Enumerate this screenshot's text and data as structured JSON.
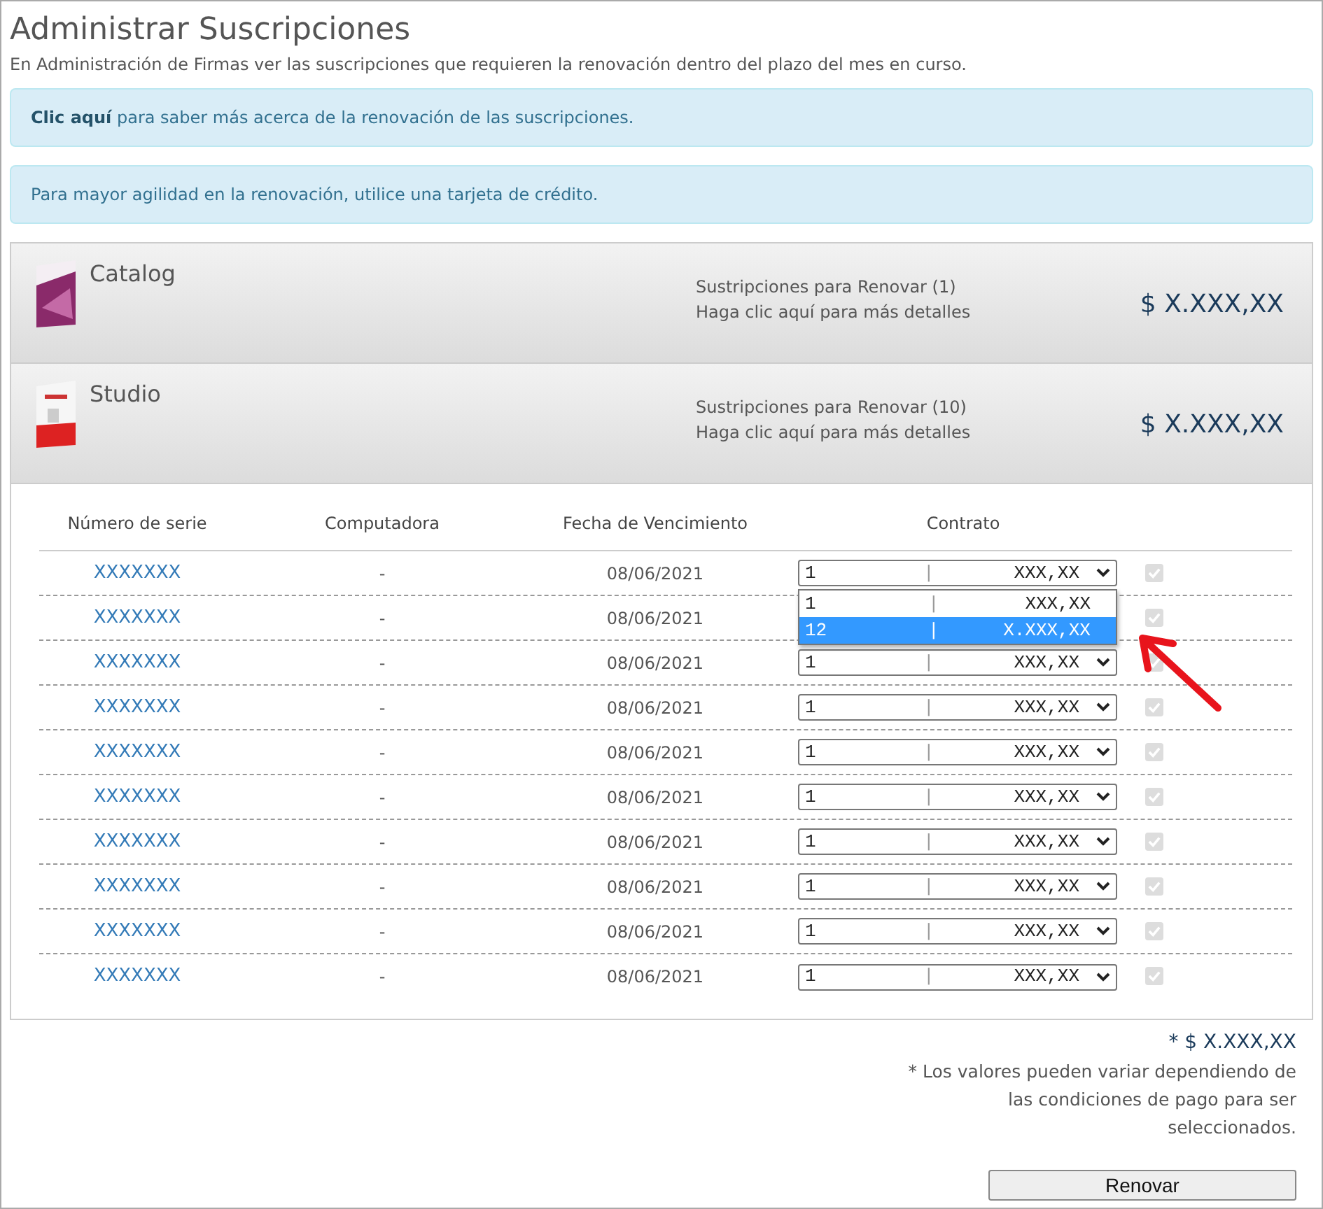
{
  "title": "Administrar Suscripciones",
  "subtitle": "En Administración de Firmas ver las suscripciones que requieren la renovación dentro del plazo del mes en curso.",
  "alerts": [
    {
      "text": "**Clic aquí** para saber más acerca de la renovación de las suscripciones."
    },
    {
      "text": "Para mayor agilidad en la renovación, utilice una tarjeta de crédito."
    }
  ],
  "products": [
    {
      "name": "Catalog",
      "kind": "catalog",
      "info": "Sustripciones para Renovar (1)",
      "details": "Haga clic aquí para más detalles",
      "price": "$ X.XXX,XX"
    },
    {
      "name": "Studio",
      "kind": "studio",
      "info": "Sustripciones para Renovar (10)",
      "details": "Haga clic aquí para más detalles",
      "price": "$ X.XXX,XX"
    }
  ],
  "table": {
    "columns": [
      "Número de serie",
      "Computadora",
      "Fecha de Vencimiento",
      "Contrato"
    ],
    "rows": [
      {
        "serial": "XXXXXXX",
        "computer": "-",
        "date": "08/06/2021",
        "contract": {
          "qty": "1",
          "sep": "|",
          "price": "XXX,XX"
        },
        "checked": true,
        "disabled": true,
        "dropdown": [
          {
            "qty": "1",
            "sep": "|",
            "price": "XXX,XX",
            "selected": false
          },
          {
            "qty": "12",
            "sep": "|",
            "price": "X.XXX,XX",
            "selected": true
          }
        ]
      },
      {
        "serial": "XXXXXXX",
        "computer": "-",
        "date": "08/06/2021",
        "checked": true,
        "disabled": true
      },
      {
        "serial": "XXXXXXX",
        "computer": "-",
        "date": "08/06/2021",
        "contract": {
          "qty": "1",
          "sep": "|",
          "price": "XXX,XX"
        },
        "checked": true,
        "disabled": true
      },
      {
        "serial": "XXXXXXX",
        "computer": "-",
        "date": "08/06/2021",
        "contract": {
          "qty": "1",
          "sep": "|",
          "price": "XXX,XX"
        },
        "checked": true,
        "disabled": true
      },
      {
        "serial": "XXXXXXX",
        "computer": "-",
        "date": "08/06/2021",
        "contract": {
          "qty": "1",
          "sep": "|",
          "price": "XXX,XX"
        },
        "checked": true,
        "disabled": true
      },
      {
        "serial": "XXXXXXX",
        "computer": "-",
        "date": "08/06/2021",
        "contract": {
          "qty": "1",
          "sep": "|",
          "price": "XXX,XX"
        },
        "checked": true,
        "disabled": true
      },
      {
        "serial": "XXXXXXX",
        "computer": "-",
        "date": "08/06/2021",
        "contract": {
          "qty": "1",
          "sep": "|",
          "price": "XXX,XX"
        },
        "checked": true,
        "disabled": true
      },
      {
        "serial": "XXXXXXX",
        "computer": "-",
        "date": "08/06/2021",
        "contract": {
          "qty": "1",
          "sep": "|",
          "price": "XXX,XX"
        },
        "checked": true,
        "disabled": true
      },
      {
        "serial": "XXXXXXX",
        "computer": "-",
        "date": "08/06/2021",
        "contract": {
          "qty": "1",
          "sep": "|",
          "price": "XXX,XX"
        },
        "checked": true,
        "disabled": true
      },
      {
        "serial": "XXXXXXX",
        "computer": "-",
        "date": "08/06/2021",
        "contract": {
          "qty": "1",
          "sep": "|",
          "price": "XXX,XX"
        },
        "checked": true,
        "disabled": true
      }
    ]
  },
  "total": "* $ X.XXX,XX",
  "note": "* Los valores pueden variar dependiendo de las condiciones de pago para ser seleccionados.",
  "button": "Renovar"
}
